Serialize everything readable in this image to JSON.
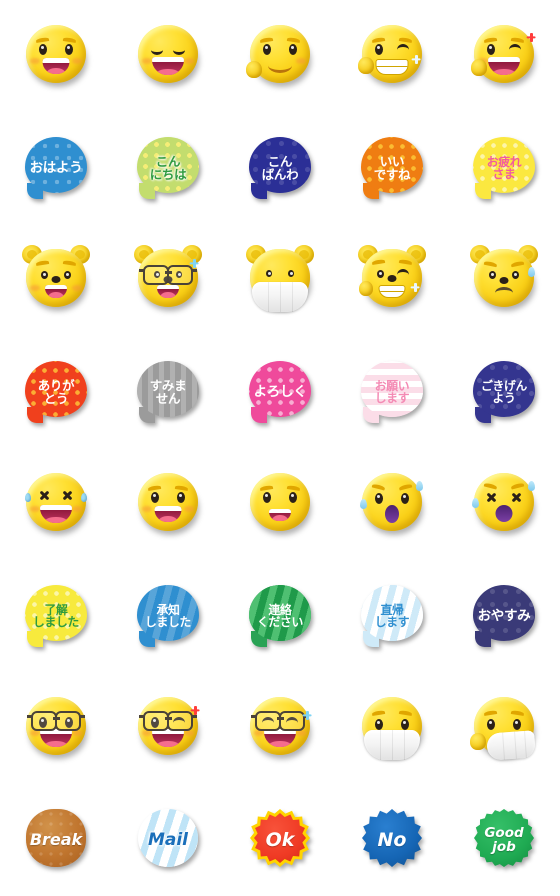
{
  "page": {
    "title": "Emoji sticker sheet",
    "background": "#ffffff",
    "columns": 5,
    "rows": 8
  },
  "rows": [
    {
      "index": 1,
      "kind": "face",
      "items": [
        {
          "name": "smiling-face-open-mouth",
          "label": "Smiling face with open mouth"
        },
        {
          "name": "smiling-face-smiling-eyes",
          "label": "Smiling face with smiling eyes"
        },
        {
          "name": "smiling-face-hand-on-chin",
          "label": "Smiling face resting hand"
        },
        {
          "name": "winking-face-grin-thumb",
          "label": "Winking grinning face with hand"
        },
        {
          "name": "winking-face-sparkle",
          "label": "Winking face with red sparkle"
        }
      ]
    },
    {
      "index": 2,
      "kind": "bubble",
      "items": [
        {
          "name": "bubble-ohayou",
          "text": "おはよう",
          "fill": "#2f8fd0",
          "text_color": "#ffffff",
          "pattern": "dots",
          "size": "t1"
        },
        {
          "name": "bubble-konnichiwa",
          "text": "こん\nにちは",
          "fill": "#c3dd6e",
          "text_color": "#2f9b3f",
          "pattern": "stars",
          "size": "t2"
        },
        {
          "name": "bubble-konbanwa",
          "text": "こん\nばんわ",
          "fill": "#2b2f96",
          "text_color": "#ffffff",
          "pattern": "dots-d",
          "size": "t2"
        },
        {
          "name": "bubble-iidesune",
          "text": "いい\nですね",
          "fill": "#ef7d12",
          "text_color": "#ffffff",
          "pattern": "stars-o",
          "size": "t2"
        },
        {
          "name": "bubble-otsukaresama",
          "text": "お疲れ\nさま",
          "fill": "#fbe840",
          "text_color": "#f25ba0",
          "pattern": "stars-w",
          "size": "t3"
        }
      ]
    },
    {
      "index": 3,
      "kind": "bear",
      "items": [
        {
          "name": "bear-smiling",
          "label": "Smiling bear face"
        },
        {
          "name": "bear-glasses",
          "label": "Bear face with glasses"
        },
        {
          "name": "bear-mask",
          "label": "Bear face with medical mask"
        },
        {
          "name": "bear-winking-grin",
          "label": "Winking grinning bear with paw"
        },
        {
          "name": "bear-sad-sweat",
          "label": "Sad bear face with sweat drop"
        }
      ]
    },
    {
      "index": 4,
      "kind": "bubble",
      "items": [
        {
          "name": "bubble-arigatou",
          "text": "ありが\nとう",
          "fill": "#f0401d",
          "text_color": "#ffffff",
          "pattern": "stars-o",
          "size": "t2"
        },
        {
          "name": "bubble-sumimasen",
          "text": "すみま\nせん",
          "fill": "#9b9b9b",
          "text_color": "#ffffff",
          "pattern": "vstripe",
          "size": "t2"
        },
        {
          "name": "bubble-yoroshiku",
          "text": "よろしく",
          "fill": "#ef4a9b",
          "text_color": "#ffffff",
          "pattern": "stars-w",
          "size": "t1"
        },
        {
          "name": "bubble-onegaishimasu",
          "text": "お願い\nします",
          "fill": "#fbdde8",
          "text_color": "#f48ab4",
          "pattern": "stripes-p",
          "size": "t3"
        },
        {
          "name": "bubble-gokigenyou",
          "text": "ごきげん\nよう",
          "fill": "#34358f",
          "text_color": "#ffffff",
          "pattern": "dots-d",
          "size": "t3"
        }
      ]
    },
    {
      "index": 5,
      "kind": "face",
      "items": [
        {
          "name": "laughing-face-tears",
          "label": "Laughing face with tears of joy"
        },
        {
          "name": "smiling-face-open-eyes",
          "label": "Smiling face with open mouth"
        },
        {
          "name": "grinning-face-simple",
          "label": "Grinning face"
        },
        {
          "name": "anguished-face-sweat",
          "label": "Anguished face with sweat"
        },
        {
          "name": "dizzy-face-x-eyes",
          "label": "Dizzy face with crossed-out eyes"
        }
      ]
    },
    {
      "index": 6,
      "kind": "bubble",
      "items": [
        {
          "name": "bubble-ryoukai-shimashita",
          "text": "了解\nしました",
          "fill": "#f7ea3d",
          "text_color": "#2f9b3f",
          "pattern": "stars-w",
          "size": "t3"
        },
        {
          "name": "bubble-shouchi-shimashita",
          "text": "承知\nしました",
          "fill": "#2f8fd0",
          "text_color": "#ffffff",
          "pattern": "stripes-b",
          "size": "t3"
        },
        {
          "name": "bubble-renraku-kudasai",
          "text": "連絡\nください",
          "fill": "#2aa255",
          "text_color": "#ffffff",
          "pattern": "stripes-g",
          "size": "t3"
        },
        {
          "name": "bubble-chokki-shimasu",
          "text": "直帰\nします",
          "fill": "#cfeaf8",
          "text_color": "#2f8fd0",
          "pattern": "stripes-b",
          "size": "t3"
        },
        {
          "name": "bubble-oyasumi",
          "text": "おやすみ",
          "fill": "#3a3a78",
          "text_color": "#ffffff",
          "pattern": "dots-d",
          "size": "t1"
        }
      ]
    },
    {
      "index": 7,
      "kind": "face",
      "items": [
        {
          "name": "face-with-glasses",
          "label": "Smiling face with glasses"
        },
        {
          "name": "face-glasses-wink-sparkle",
          "label": "Winking face with glasses and sparkle"
        },
        {
          "name": "face-glasses-wink-sweat",
          "label": "Winking face with glasses and sweat"
        },
        {
          "name": "face-with-mask",
          "label": "Face with medical mask"
        },
        {
          "name": "face-with-mask-hand",
          "label": "Face with medical mask and hand"
        }
      ]
    },
    {
      "index": 8,
      "kind": "badge",
      "items": [
        {
          "name": "badge-break",
          "text": "Break",
          "fill": "#c0752e",
          "text_color": "#ffffff",
          "shape": "cookie",
          "size": 16
        },
        {
          "name": "badge-mail",
          "text": "Mail",
          "fill": "#d8eefb",
          "text_color": "#1a6fba",
          "shape": "circle",
          "size": 17
        },
        {
          "name": "badge-ok",
          "text": "Ok",
          "fill": "#ef3a24",
          "text_color": "#ffffff",
          "shape": "starburst",
          "size": 19,
          "edge": "#ffd400"
        },
        {
          "name": "badge-no",
          "text": "No",
          "fill": "#1565b4",
          "text_color": "#ffffff",
          "shape": "starburst",
          "size": 19,
          "edge": "#1565b4"
        },
        {
          "name": "badge-good-job",
          "text": "Good\njob",
          "fill": "#1faa52",
          "text_color": "#ffffff",
          "shape": "scallop",
          "size": 13,
          "edge": "#1faa52"
        }
      ]
    }
  ]
}
